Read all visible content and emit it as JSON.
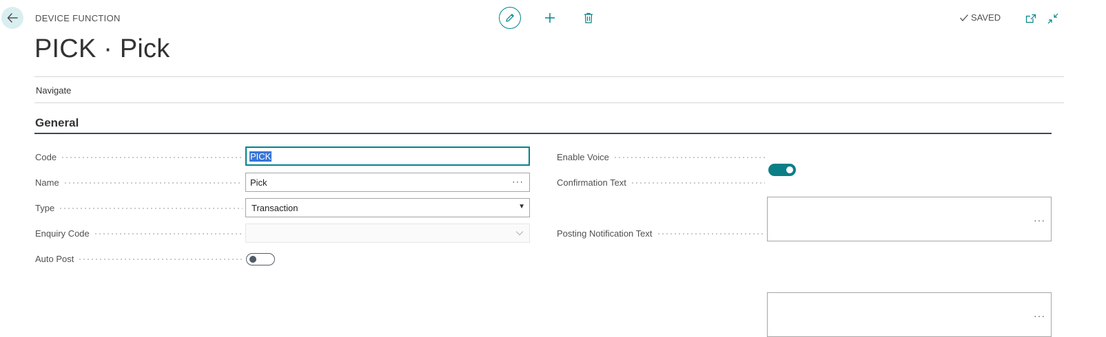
{
  "header": {
    "caption": "DEVICE FUNCTION",
    "title": "PICK · Pick",
    "saved_label": "SAVED"
  },
  "actions": {
    "navigate_label": "Navigate"
  },
  "section": {
    "title": "General"
  },
  "fields": {
    "code": {
      "label": "Code",
      "value": "PICK"
    },
    "name": {
      "label": "Name",
      "value": "Pick",
      "assist": "···"
    },
    "type": {
      "label": "Type",
      "value": "Transaction",
      "caret": "▼"
    },
    "enquiry_code": {
      "label": "Enquiry Code",
      "value": ""
    },
    "auto_post": {
      "label": "Auto Post",
      "on": false
    },
    "enable_voice": {
      "label": "Enable Voice",
      "on": true
    },
    "confirmation_text": {
      "label": "Confirmation Text",
      "value": "",
      "assist": "···"
    },
    "posting_notification_text": {
      "label": "Posting Notification Text",
      "value": "",
      "assist": "···"
    }
  },
  "colors": {
    "accent": "#008489",
    "toggle_on": "#0b7f86",
    "back_bg": "#d9eef0",
    "section_line": "#3a4a5a"
  },
  "icons": [
    "back-arrow-icon",
    "pencil-icon",
    "plus-icon",
    "trash-icon",
    "checkmark-icon",
    "popout-icon",
    "collapse-icon",
    "chevron-down-icon"
  ]
}
